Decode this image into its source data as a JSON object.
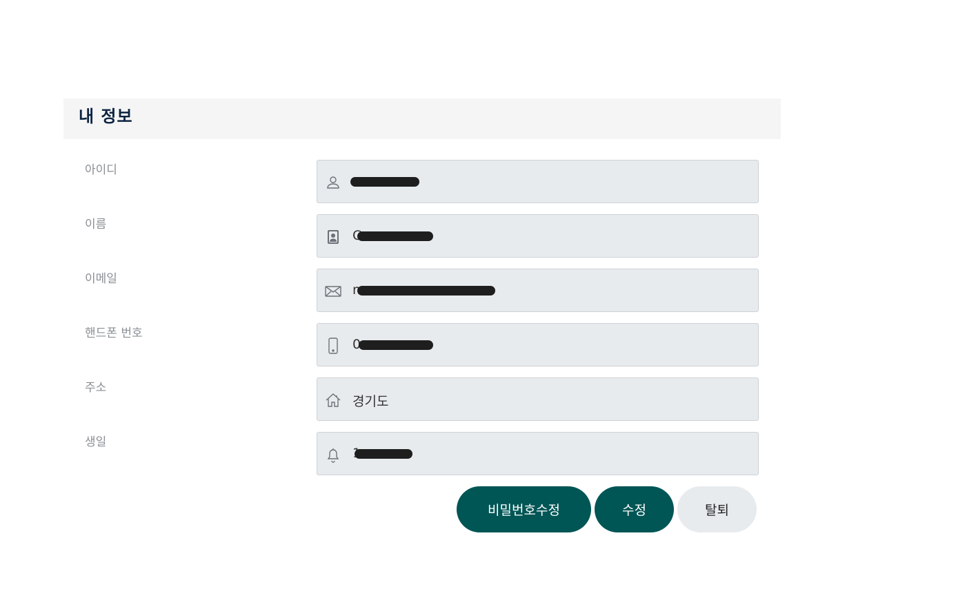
{
  "section": {
    "title": "내 정보"
  },
  "fields": [
    {
      "key": "id",
      "label": "아이디",
      "icon": "person-icon",
      "value": "           "
    },
    {
      "key": "name",
      "label": "이름",
      "icon": "contact-card-icon",
      "value": "C"
    },
    {
      "key": "email",
      "label": "이메일",
      "icon": "envelope-icon",
      "value": "                                m"
    },
    {
      "key": "phone",
      "label": "핸드폰 번호",
      "icon": "phone-icon",
      "value": "0"
    },
    {
      "key": "address",
      "label": "주소",
      "icon": "house-icon",
      "value": "경기도"
    },
    {
      "key": "birthday",
      "label": "생일",
      "icon": "bell-icon",
      "value": "1"
    }
  ],
  "buttons": {
    "change_password": "비밀번호수정",
    "edit": "수정",
    "withdraw": "탈퇴"
  },
  "colors": {
    "primary": "#005555",
    "field_bg": "#e8ebee",
    "header_bg": "#f5f5f5",
    "title": "#0c2340",
    "label": "#8a8f94"
  }
}
